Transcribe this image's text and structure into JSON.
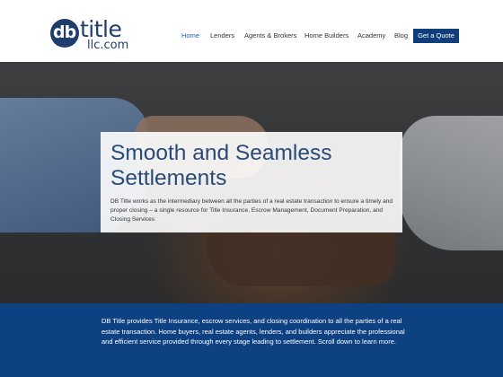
{
  "brand": {
    "logo_db": "db",
    "logo_title": "title",
    "logo_llc": "llc.com",
    "brand_color": "#1f3d6b"
  },
  "nav": {
    "items": [
      {
        "label": "Home",
        "active": true
      },
      {
        "label": "Lenders",
        "active": false
      },
      {
        "label": "Agents & Brokers",
        "active": false
      },
      {
        "label": "Home Builders",
        "active": false
      },
      {
        "label": "Academy",
        "active": false
      },
      {
        "label": "Blog",
        "active": false
      }
    ],
    "cta_label": "Get a Quote",
    "active_color": "#1f5fa8",
    "cta_color": "#0e3f7a"
  },
  "hero": {
    "title": "Smooth and Seamless Settlements",
    "text": "DB Title works as the intermediary between all the parties of a real estate transaction to ensure a timely and proper closing – a single resource for Title Insurance, Escrow Management, Document Preparation, and Closing Services",
    "image": "handshake-photo"
  },
  "band": {
    "text": "DB Title provides Title Insurance, escrow services, and closing coordination to all the parties of a real estate transaction. Home buyers, real estate agents, lenders, and builders appreciate the professional and efficient service provided through every stage leading to settlement. Scroll down to learn more.",
    "color": "#0e4182"
  }
}
